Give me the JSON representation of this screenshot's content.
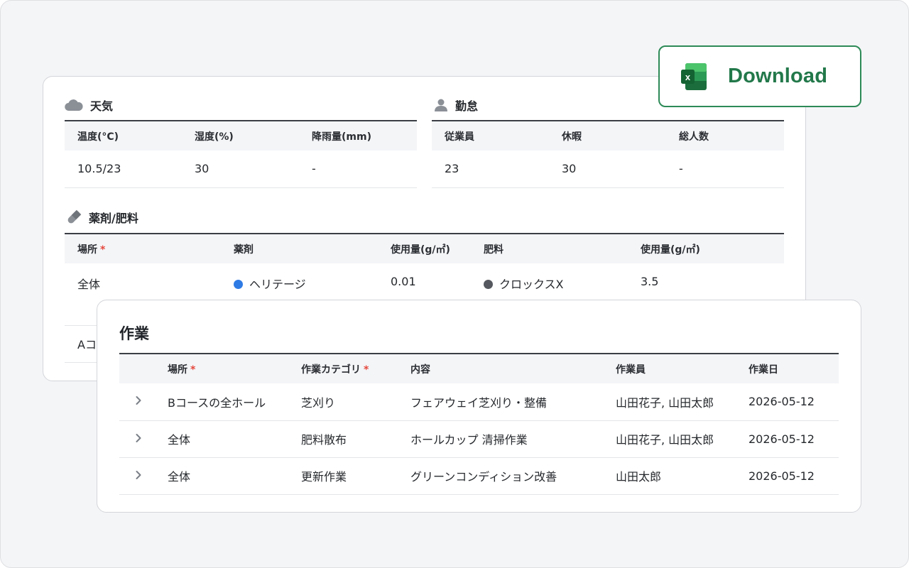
{
  "download": {
    "label": "Download",
    "icon": "excel-icon"
  },
  "weather": {
    "title": "天気",
    "icon": "cloud-icon",
    "headers": [
      "温度(°C)",
      "湿度(%)",
      "降雨量(mm)"
    ],
    "row": [
      "10.5/23",
      "30",
      "-"
    ]
  },
  "attendance": {
    "title": "勤怠",
    "icon": "user-icon",
    "headers": [
      "従業員",
      "休暇",
      "総人数"
    ],
    "row": [
      "23",
      "30",
      "-"
    ]
  },
  "chemicals": {
    "title": "薬剤/肥料",
    "icon": "pill-icon",
    "headers": [
      "場所",
      "薬剤",
      "使用量(g/㎡)",
      "肥料",
      "使用量(g/㎡)"
    ],
    "required_mark": "*",
    "rows": [
      {
        "place": "全体",
        "chemical": "ヘリテージ",
        "chemical_color": "#2f7be5",
        "chemical_amount": "0.01",
        "fertilizer": "クロックスX",
        "fertilizer_color": "#55595f",
        "fertilizer_amount": "3.5"
      },
      {
        "place": "Aコ",
        "chemical": "",
        "chemical_amount": "",
        "fertilizer": "",
        "fertilizer_amount": ""
      }
    ]
  },
  "work": {
    "title": "作業",
    "required_mark": "*",
    "headers": [
      "場所",
      "作業カテゴリ",
      "内容",
      "作業員",
      "作業日"
    ],
    "rows": [
      {
        "place": "Bコースの全ホール",
        "category": "芝刈り",
        "content": "フェアウェイ芝刈り・整備",
        "workers": "山田花子, 山田太郎",
        "date": "2026-05-12"
      },
      {
        "place": "全体",
        "category": "肥料散布",
        "content": "ホールカップ 清掃作業",
        "workers": "山田花子, 山田太郎",
        "date": "2026-05-12"
      },
      {
        "place": "全体",
        "category": "更新作業",
        "content": "グリーンコンディション改善",
        "workers": "山田太郎",
        "date": "2026-05-12"
      }
    ]
  },
  "colors": {
    "accent_green": "#22784a",
    "required": "#e5483d"
  }
}
